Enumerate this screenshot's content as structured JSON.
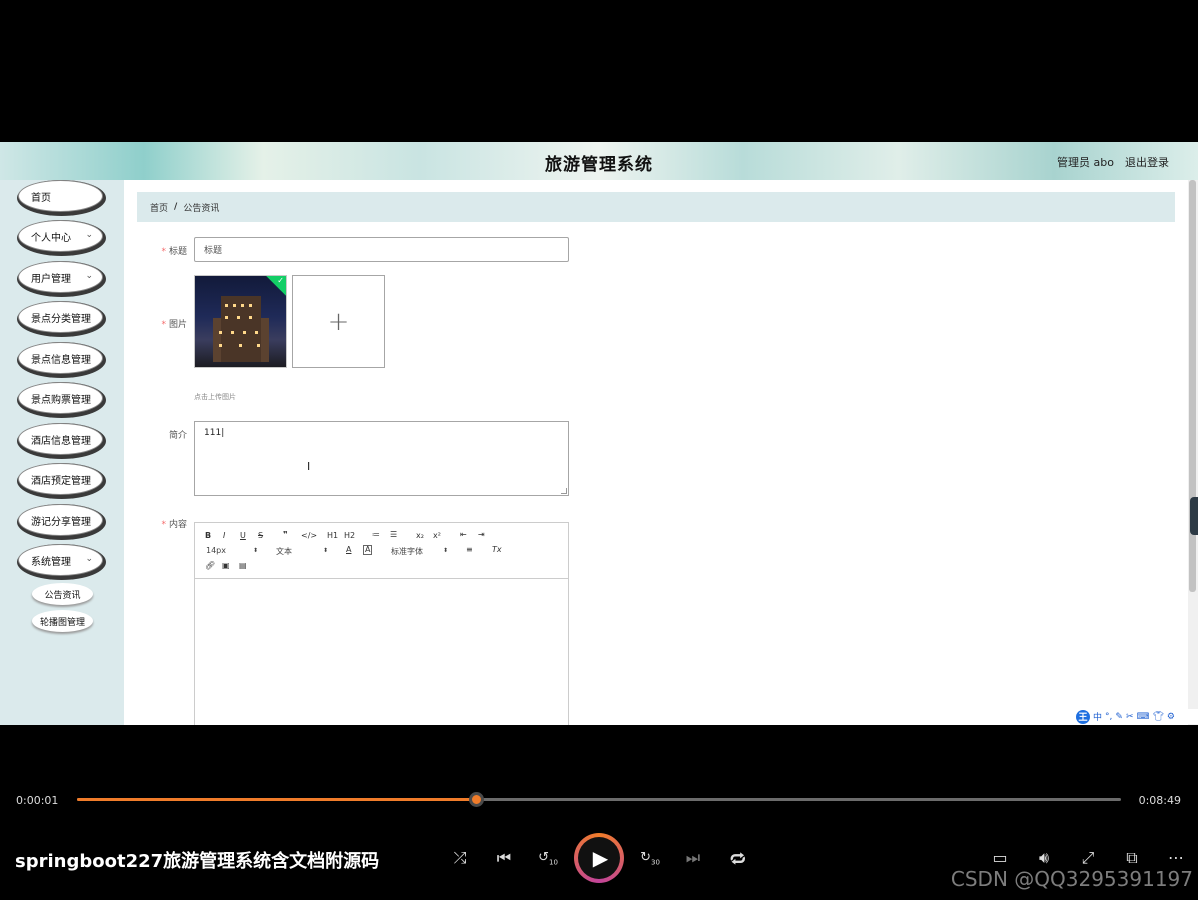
{
  "header": {
    "title": "旅游管理系统",
    "user": "管理员 abo",
    "logout": "退出登录"
  },
  "sidebar": {
    "items": [
      {
        "label": "首页",
        "has_children": false
      },
      {
        "label": "个人中心",
        "has_children": true
      },
      {
        "label": "用户管理",
        "has_children": true
      },
      {
        "label": "景点分类管理",
        "has_children": false
      },
      {
        "label": "景点信息管理",
        "has_children": false
      },
      {
        "label": "景点购票管理",
        "has_children": false
      },
      {
        "label": "酒店信息管理",
        "has_children": false
      },
      {
        "label": "酒店预定管理",
        "has_children": false
      },
      {
        "label": "游记分享管理",
        "has_children": false
      },
      {
        "label": "系统管理",
        "has_children": true
      }
    ],
    "sub_items": [
      {
        "label": "公告资讯"
      },
      {
        "label": "轮播图管理"
      }
    ]
  },
  "breadcrumb": {
    "home": "首页",
    "separator": "/",
    "current": "公告资讯"
  },
  "form": {
    "title_label": "标题",
    "title_placeholder": "标题",
    "image_label": "图片",
    "upload_tip": "点击上传图片",
    "upload_plus": "+",
    "summary_label": "简介",
    "summary_value": "111",
    "content_label": "内容",
    "required_mark": "*"
  },
  "editor": {
    "row1": [
      "B",
      "I",
      "U",
      "S",
      "❞",
      "</>",
      "H1",
      "H2",
      "≔",
      "☰",
      "x₂",
      "x²",
      "⇤",
      "⇥"
    ],
    "size_select": "14px",
    "text_select": "文本",
    "font_select": "标准字体",
    "row2_icons": [
      "A",
      "A",
      "≡",
      "Tx"
    ],
    "row3_icons": [
      "link-icon",
      "image-icon",
      "video-icon"
    ]
  },
  "ime": {
    "logo": "王",
    "mode": "中"
  },
  "player": {
    "current_time": "0:00:01",
    "total_time": "0:08:49",
    "progress_percent": 38.2,
    "video_title": "springboot227旅游管理系统含文档附源码",
    "rewind_seconds": "10",
    "forward_seconds": "30",
    "watermark": "CSDN @QQ3295391197"
  }
}
